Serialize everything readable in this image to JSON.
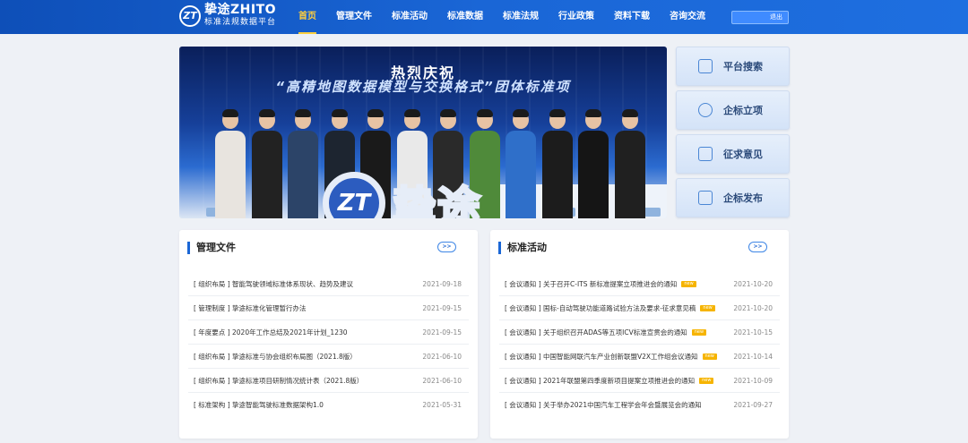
{
  "header": {
    "logo_mark": "ZT",
    "logo_name": "挚途ZHITO",
    "logo_sub": "标准法规数据平台",
    "nav": [
      {
        "label": "首页",
        "active": true
      },
      {
        "label": "管理文件"
      },
      {
        "label": "标准活动"
      },
      {
        "label": "标准数据"
      },
      {
        "label": "标准法规"
      },
      {
        "label": "行业政策"
      },
      {
        "label": "资料下载"
      },
      {
        "label": "咨询交流"
      }
    ],
    "logout_label": "退出"
  },
  "banner": {
    "title": "热烈庆祝",
    "subtitle": "“高精地图数据模型与交换格式”团体标准项",
    "logo_mark": "ZT",
    "logo_text": "挚途"
  },
  "side_buttons": [
    {
      "label": "平台搜索",
      "icon": "search-icon"
    },
    {
      "label": "企标立项",
      "icon": "user-add-icon"
    },
    {
      "label": "征求意见",
      "icon": "clipboard-icon"
    },
    {
      "label": "企标发布",
      "icon": "document-icon"
    }
  ],
  "panels": {
    "left": {
      "title": "管理文件",
      "more_label": ">>",
      "rows": [
        {
          "title": "[ 组织布局 ] 智能驾驶领域标准体系现状、趋势及建议",
          "date": "2021-09-18",
          "new": false
        },
        {
          "title": "[ 管理制度 ] 挚途标准化管理暂行办法",
          "date": "2021-09-15",
          "new": false
        },
        {
          "title": "[ 年度要点 ] 2020年工作总结及2021年计划_1230",
          "date": "2021-09-15",
          "new": false
        },
        {
          "title": "[ 组织布局 ] 挚途标准与协会组织布局图（2021.8版）",
          "date": "2021-06-10",
          "new": false
        },
        {
          "title": "[ 组织布局 ] 挚途标准项目研制情况统计表（2021.8版）",
          "date": "2021-06-10",
          "new": false
        },
        {
          "title": "[ 标准架构 ] 挚途智能驾驶标准数据架构1.0",
          "date": "2021-05-31",
          "new": false
        }
      ]
    },
    "right": {
      "title": "标准活动",
      "more_label": ">>",
      "new_label": "new",
      "rows": [
        {
          "title": "[ 会议通知 ] 关于召开C-ITS 新标准提案立项推进会的通知",
          "date": "2021-10-20",
          "new": true
        },
        {
          "title": "[ 会议通知 ] 国标-自动驾驶功能道路试验方法及要求-征求意见稿",
          "date": "2021-10-20",
          "new": true
        },
        {
          "title": "[ 会议通知 ] 关于组织召开ADAS等五项ICV标准宣贯会的通知",
          "date": "2021-10-15",
          "new": true
        },
        {
          "title": "[ 会议通知 ] 中国智能网联汽车产业创新联盟V2X工作组会议通知",
          "date": "2021-10-14",
          "new": true
        },
        {
          "title": "[ 会议通知 ] 2021年联盟第四季度新项目提案立项推进会的通知",
          "date": "2021-10-09",
          "new": true
        },
        {
          "title": "[ 会议通知 ] 关于举办2021中国汽车工程学会年会暨展览会的通知",
          "date": "2021-09-27",
          "new": false
        }
      ]
    }
  },
  "colors": {
    "header_blue": "#1a66d6",
    "active_nav": "#ffcf3d",
    "new_badge": "#f6b400"
  }
}
